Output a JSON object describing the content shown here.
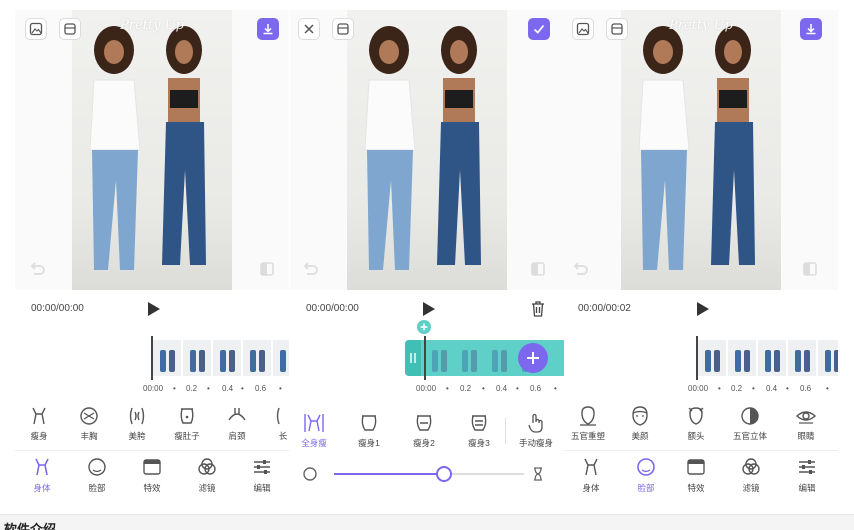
{
  "colors": {
    "accent": "#7b68ee",
    "teal": "#5ed0c8",
    "denim": "#3f6da2"
  },
  "watermark": "Pretty Up",
  "panel1": {
    "time": "00:00/00:00",
    "ticks": [
      "00:00",
      "•",
      "0.2",
      "•",
      "0.4",
      "•",
      "0.6",
      "•"
    ],
    "tools": [
      "瘦身",
      "丰胸",
      "美胯",
      "瘦肚子",
      "肩颈",
      "长"
    ],
    "nav": [
      "身体",
      "脸部",
      "特效",
      "滤镜",
      "编辑"
    ],
    "active_nav": 0
  },
  "panel2": {
    "time": "00:00/00:00",
    "ticks": [
      "00:00",
      "•",
      "0.2",
      "•",
      "0.4",
      "•",
      "0.6",
      "•"
    ],
    "tools": [
      "全身瘦",
      "瘦身1",
      "瘦身2",
      "瘦身3",
      "手动瘦身"
    ],
    "active_tool": 0,
    "slider": {
      "value": 0.58
    }
  },
  "panel3": {
    "time": "00:00/00:02",
    "ticks": [
      "00:00",
      "•",
      "0.2",
      "•",
      "0.4",
      "•",
      "0.6",
      "•"
    ],
    "tools": [
      "五官重塑",
      "美颜",
      "额头",
      "五官立体",
      "眼睛"
    ],
    "nav": [
      "身体",
      "脸部",
      "特效",
      "滤镜",
      "编辑"
    ],
    "active_nav": 1
  },
  "caption": "软件介绍"
}
